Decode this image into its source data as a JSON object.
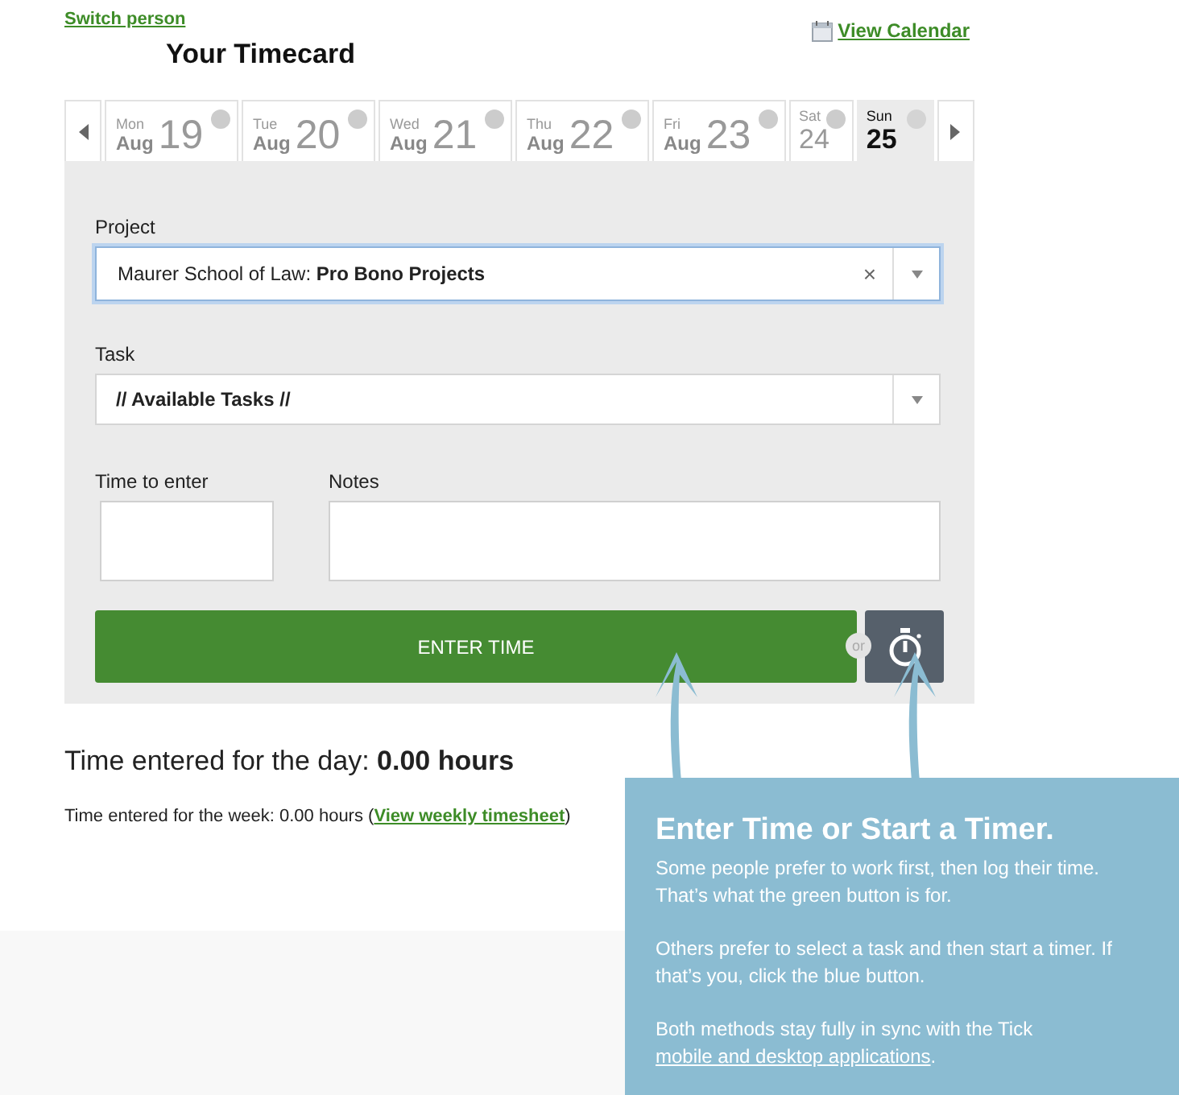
{
  "header": {
    "switch_link": "Switch person",
    "title": "Your Timecard",
    "calendar_link": "View Calendar"
  },
  "days": [
    {
      "weekday": "Mon",
      "month": "Aug",
      "day": "19",
      "selected": false
    },
    {
      "weekday": "Tue",
      "month": "Aug",
      "day": "20",
      "selected": false
    },
    {
      "weekday": "Wed",
      "month": "Aug",
      "day": "21",
      "selected": false
    },
    {
      "weekday": "Thu",
      "month": "Aug",
      "day": "22",
      "selected": false
    },
    {
      "weekday": "Fri",
      "month": "Aug",
      "day": "23",
      "selected": false
    },
    {
      "weekday": "Sat",
      "day": "24",
      "selected": false
    },
    {
      "weekday": "Sun",
      "day": "25",
      "selected": true
    }
  ],
  "form": {
    "project": {
      "label": "Project",
      "value": "Maurer School of Law: **Pro Bono Projects**",
      "clear": "×"
    },
    "task": {
      "label": "Task",
      "value": "// Available Tasks //"
    },
    "time": {
      "label": "Time to enter"
    },
    "notes": {
      "label": "Notes"
    },
    "enter_button": "ENTER TIME",
    "or": "or"
  },
  "totals": {
    "day": "Time entered for the day: **0.00 hours**",
    "week_before": "Time entered for the week: 0.00 hours (",
    "week_link": "View weekly timesheet",
    "week_after": ")"
  },
  "tip": {
    "title": "Enter Time or Start a Timer.",
    "paragraphs": [
      {
        "text": "Some people prefer to work first, then log their time. That’s what the green button is for."
      },
      {
        "text": "Others prefer to select a task and then start a timer. If that’s you, click the blue button."
      },
      {
        "text": "Both methods stay fully in sync with the Tick ",
        "link": "mobile and desktop applications",
        "after": "."
      }
    ]
  }
}
